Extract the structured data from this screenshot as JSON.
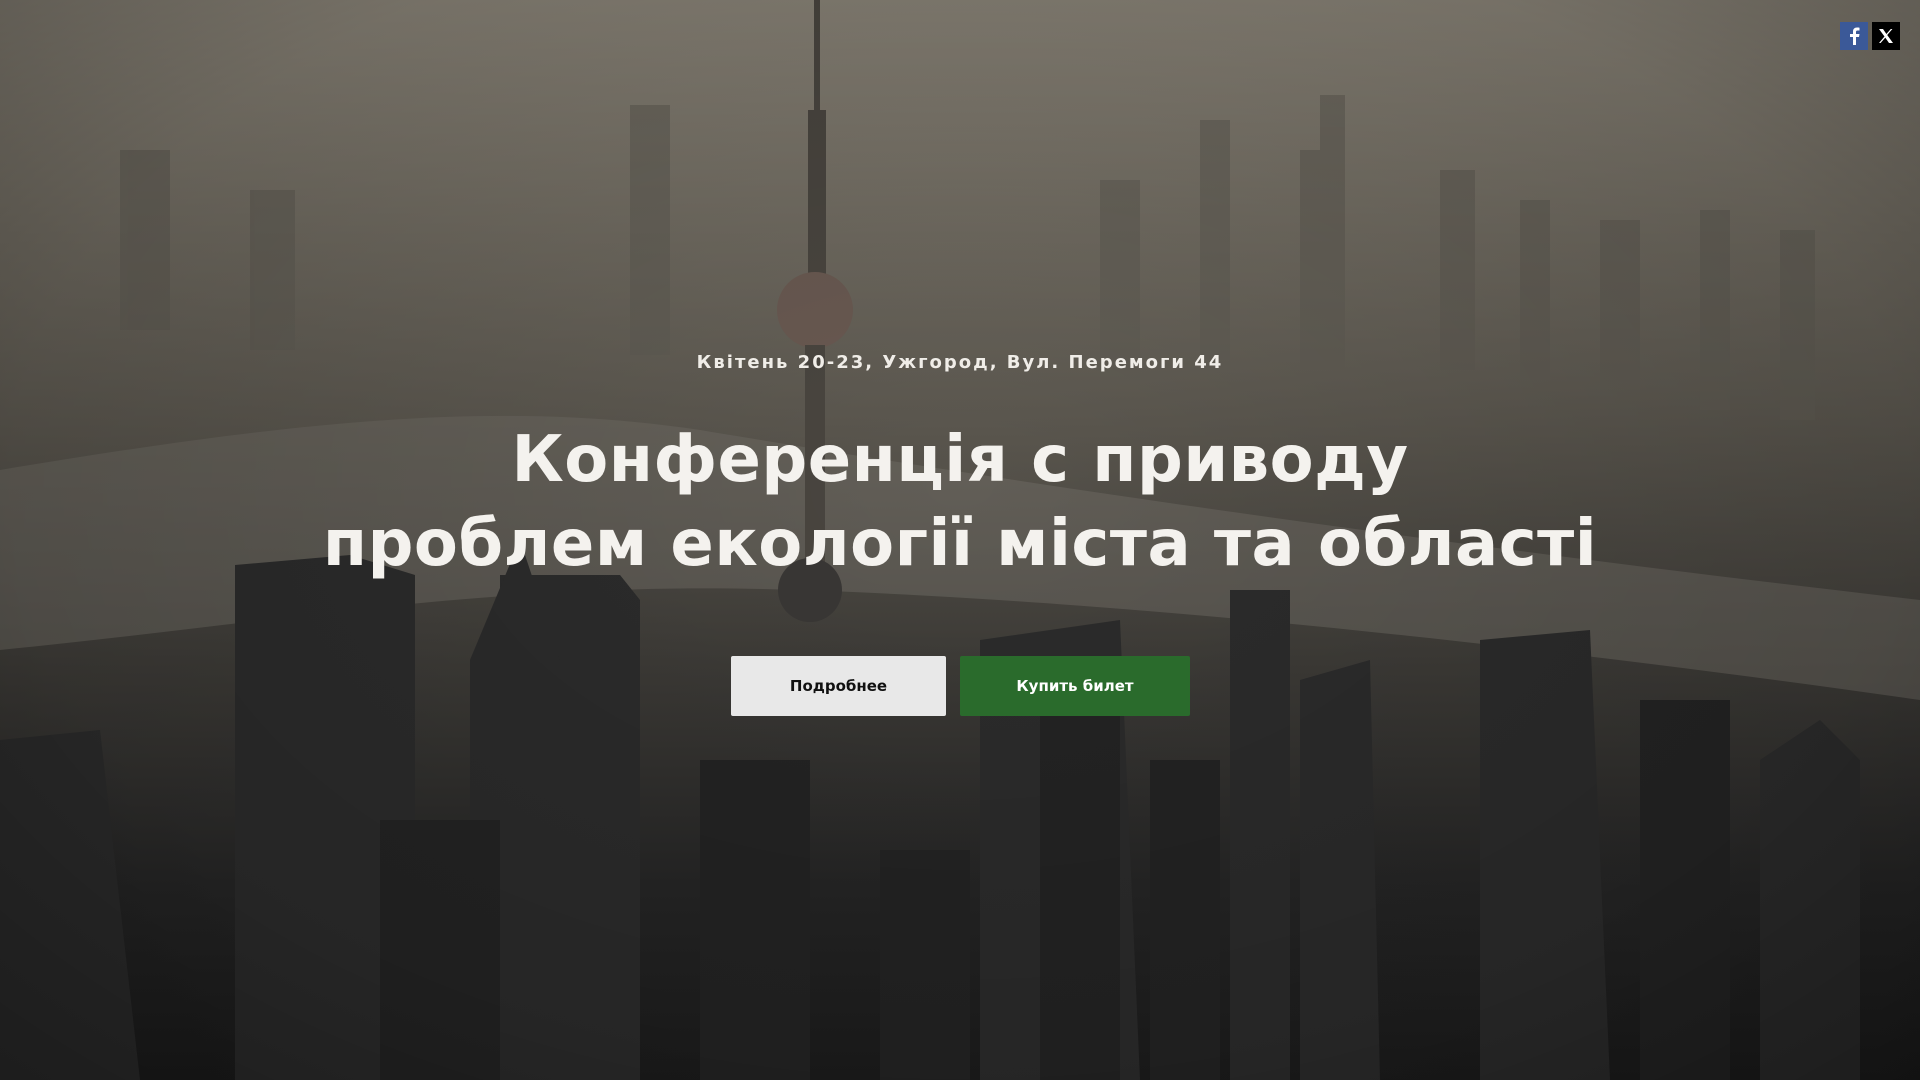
{
  "social": {
    "facebook_icon": "facebook-icon",
    "x_icon": "x-twitter-icon",
    "facebook_color": "#3b5998",
    "x_color": "#000000"
  },
  "hero": {
    "event_info": "Квітень 20-23, Ужгород, Вул. Перемоги 44",
    "title_line1": "Конференція с приводу",
    "title_line2": "проблем екології міста та області",
    "more_button_label": "Подробнее",
    "buy_button_label": "Купить билет",
    "buy_button_color": "#2a6b2c",
    "more_button_color": "#e8e8e8"
  }
}
